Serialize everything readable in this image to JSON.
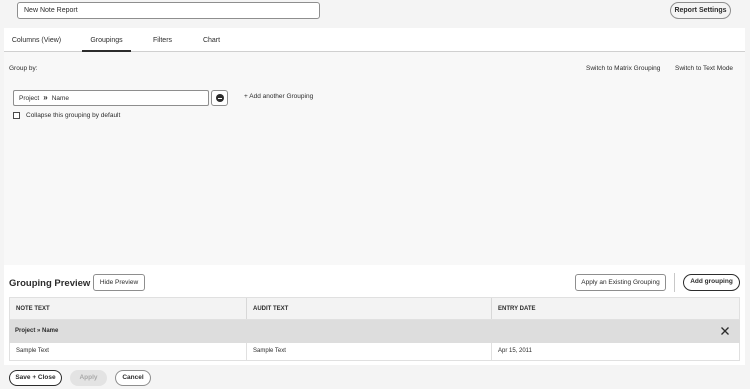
{
  "header": {
    "report_name_value": "New Note Report",
    "report_settings_label": "Report Settings"
  },
  "tabs": [
    {
      "label": "Columns (View)",
      "active": false
    },
    {
      "label": "Groupings",
      "active": true
    },
    {
      "label": "Filters",
      "active": false
    },
    {
      "label": "Chart",
      "active": false
    }
  ],
  "groupings": {
    "group_by_label": "Group by:",
    "switch_matrix_label": "Switch to Matrix Grouping",
    "switch_text_label": "Switch to Text Mode",
    "field_part1": "Project",
    "field_separator": "»",
    "field_part2": "Name",
    "add_another_label": "+ Add another Grouping",
    "collapse_label": "Collapse this grouping by default",
    "collapse_checked": false
  },
  "preview": {
    "title": "Grouping Preview",
    "hide_preview_label": "Hide Preview",
    "apply_existing_label": "Apply an Existing Grouping",
    "add_grouping_label": "Add grouping",
    "columns": [
      "NOTE TEXT",
      "AUDIT TEXT",
      "ENTRY DATE"
    ],
    "group_row_label": "Project » Name",
    "rows": [
      [
        "Sample Text",
        "Sample Text",
        "Apr 15, 2011"
      ]
    ]
  },
  "footer": {
    "save_close_label": "Save + Close",
    "apply_label": "Apply",
    "cancel_label": "Cancel"
  },
  "icons": {
    "remove_grouping": "minus-circle-icon",
    "close_group": "close-icon"
  },
  "colors": {
    "text": "#2c2c2c",
    "border": "#8e8e8e",
    "group_row_bg": "#dddddd",
    "disabled_bg": "#e3e3e3"
  }
}
